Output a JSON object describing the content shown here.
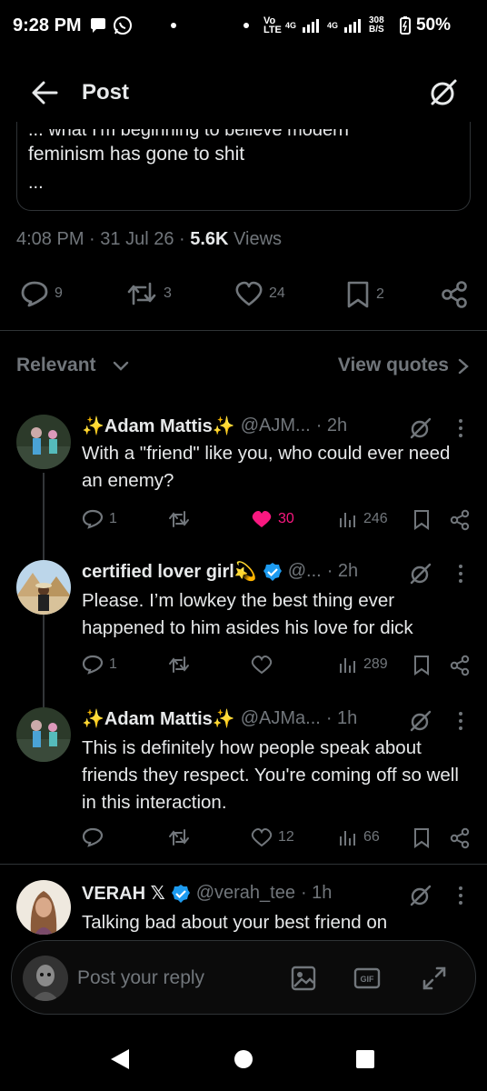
{
  "status_bar": {
    "time": "9:28 PM",
    "network_lte": "Vo LTE",
    "network_4g": "4G",
    "network_4g_b": "4G",
    "data_rate": "308 B/S",
    "battery": "50%"
  },
  "header": {
    "title": "Post"
  },
  "quote": {
    "hidden_line": "... what I'm beginning to believe modern",
    "line": "feminism has gone to shit",
    "ellipsis": "..."
  },
  "meta": {
    "time": "4:08 PM",
    "sep1": " · ",
    "date": "31 Jul 26",
    "sep2": " · ",
    "views": "5.6K",
    "views_label": " Views"
  },
  "actions": {
    "replies": "9",
    "reposts": "3",
    "likes": "24",
    "bookmarks": "2"
  },
  "sort": {
    "label": "Relevant",
    "view_quotes": "View quotes"
  },
  "replies": [
    {
      "name": "✨Adam Mattis✨",
      "handle": "@AJM...",
      "time": "· 2h",
      "body": "With a \"friend\" like you, who could ever need an enemy?",
      "reply_count": "1",
      "repost_count": "",
      "like_count": "30",
      "liked": true,
      "views": "246"
    },
    {
      "name": "certified lover girl💫",
      "handle": "@...",
      "time": "· 2h",
      "body": "Please. I’m lowkey the best thing ever happened to him asides his love for dick",
      "reply_count": "1",
      "repost_count": "",
      "like_count": "",
      "views": "289"
    },
    {
      "name": "✨Adam Mattis✨",
      "handle": "@AJMa...",
      "time": "· 1h",
      "body": "This is definitely how people speak about friends they respect. You're coming off so well in this interaction.",
      "reply_count": "",
      "repost_count": "",
      "like_count": "12",
      "views": "66"
    },
    {
      "name": "VERAH 𝕏",
      "handle": "@verah_tee",
      "time": "· 1h",
      "body": "Talking bad about your best friend on"
    }
  ],
  "reply_bar": {
    "placeholder": "Post your reply"
  },
  "colors": {
    "background": "#000000",
    "text": "#e7e9ea",
    "muted": "#71767b",
    "like": "#f91880",
    "verified": "#1d9bf0",
    "border": "#2f3336"
  },
  "icons": [
    "back-arrow-icon",
    "grok-icon",
    "reply-icon",
    "repost-icon",
    "heart-icon",
    "bookmark-icon",
    "share-icon",
    "views-icon",
    "more-icon",
    "image-icon",
    "gif-icon",
    "expand-icon",
    "verified-icon"
  ]
}
